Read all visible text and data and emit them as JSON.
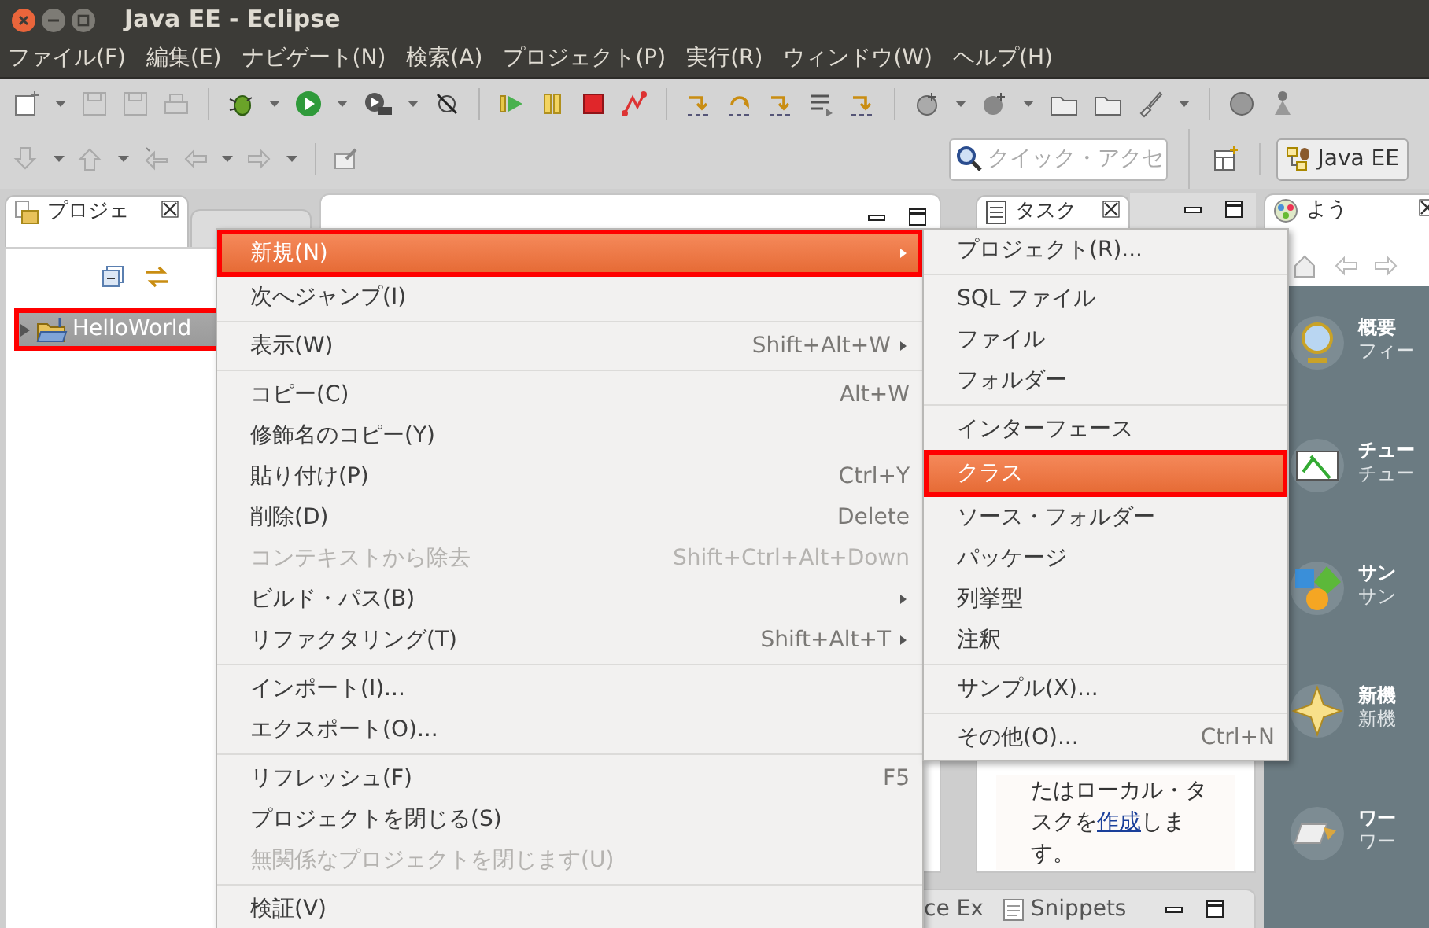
{
  "window": {
    "title": "Java EE - Eclipse"
  },
  "menu_bar": [
    {
      "label": "ファイル(F)"
    },
    {
      "label": "編集(E)"
    },
    {
      "label": "ナビゲート(N)"
    },
    {
      "label": "検索(A)"
    },
    {
      "label": "プロジェクト(P)"
    },
    {
      "label": "実行(R)"
    },
    {
      "label": "ウィンドウ(W)"
    },
    {
      "label": "ヘルプ(H)"
    }
  ],
  "quick_access": {
    "placeholder": "クイック・アクセ"
  },
  "perspective": {
    "label": "Java EE",
    "selected": true
  },
  "project_explorer": {
    "tab": "プロジェ",
    "tree": [
      {
        "label": "HelloWorld",
        "selected": true,
        "framed": true,
        "expanded": false
      }
    ]
  },
  "context_menu": {
    "items": [
      {
        "kind": "item",
        "label": "新規(N)",
        "submenu": true,
        "disabled": false,
        "selected": true,
        "framed": true
      },
      {
        "kind": "item",
        "label": "次へジャンプ(I)",
        "submenu": false,
        "disabled": false,
        "selected": false,
        "framed": false
      },
      {
        "kind": "separator"
      },
      {
        "kind": "item",
        "label": "表示(W)",
        "shortcut": "Shift+Alt+W",
        "submenu": true,
        "disabled": false,
        "selected": false,
        "framed": false
      },
      {
        "kind": "separator"
      },
      {
        "kind": "item",
        "label": "コピー(C)",
        "shortcut": "Alt+W",
        "submenu": false,
        "disabled": false,
        "selected": false,
        "framed": false
      },
      {
        "kind": "item",
        "label": "修飾名のコピー(Y)",
        "submenu": false,
        "disabled": false,
        "selected": false,
        "framed": false
      },
      {
        "kind": "item",
        "label": "貼り付け(P)",
        "shortcut": "Ctrl+Y",
        "submenu": false,
        "disabled": false,
        "selected": false,
        "framed": false
      },
      {
        "kind": "item",
        "label": "削除(D)",
        "shortcut": "Delete",
        "submenu": false,
        "disabled": false,
        "selected": false,
        "framed": false
      },
      {
        "kind": "item",
        "label": "コンテキストから除去",
        "shortcut": "Shift+Ctrl+Alt+Down",
        "submenu": false,
        "disabled": true,
        "selected": false,
        "framed": false
      },
      {
        "kind": "item",
        "label": "ビルド・パス(B)",
        "submenu": true,
        "disabled": false,
        "selected": false,
        "framed": false
      },
      {
        "kind": "item",
        "label": "リファクタリング(T)",
        "shortcut": "Shift+Alt+T",
        "submenu": true,
        "disabled": false,
        "selected": false,
        "framed": false
      },
      {
        "kind": "separator"
      },
      {
        "kind": "item",
        "label": "インポート(I)...",
        "submenu": false,
        "disabled": false,
        "selected": false,
        "framed": false
      },
      {
        "kind": "item",
        "label": "エクスポート(O)...",
        "submenu": false,
        "disabled": false,
        "selected": false,
        "framed": false
      },
      {
        "kind": "separator"
      },
      {
        "kind": "item",
        "label": "リフレッシュ(F)",
        "shortcut": "F5",
        "submenu": false,
        "disabled": false,
        "selected": false,
        "framed": false
      },
      {
        "kind": "item",
        "label": "プロジェクトを閉じる(S)",
        "submenu": false,
        "disabled": false,
        "selected": false,
        "framed": false
      },
      {
        "kind": "item",
        "label": "無関係なプロジェクトを閉じます(U)",
        "submenu": false,
        "disabled": true,
        "selected": false,
        "framed": false
      },
      {
        "kind": "separator"
      },
      {
        "kind": "item",
        "label": "検証(V)",
        "submenu": false,
        "disabled": false,
        "selected": false,
        "framed": false
      }
    ]
  },
  "submenu": {
    "items": [
      {
        "kind": "item",
        "label": "プロジェクト(R)...",
        "submenu": false,
        "disabled": false,
        "selected": false,
        "framed": false
      },
      {
        "kind": "separator"
      },
      {
        "kind": "item",
        "label": "SQL ファイル",
        "submenu": false,
        "disabled": false,
        "selected": false,
        "framed": false
      },
      {
        "kind": "item",
        "label": "ファイル",
        "submenu": false,
        "disabled": false,
        "selected": false,
        "framed": false
      },
      {
        "kind": "item",
        "label": "フォルダー",
        "submenu": false,
        "disabled": false,
        "selected": false,
        "framed": false
      },
      {
        "kind": "separator"
      },
      {
        "kind": "item",
        "label": "インターフェース",
        "submenu": false,
        "disabled": false,
        "selected": false,
        "framed": false
      },
      {
        "kind": "item",
        "label": "クラス",
        "submenu": false,
        "disabled": false,
        "selected": true,
        "framed": true
      },
      {
        "kind": "item",
        "label": "ソース・フォルダー",
        "submenu": false,
        "disabled": false,
        "selected": false,
        "framed": false
      },
      {
        "kind": "item",
        "label": "パッケージ",
        "submenu": false,
        "disabled": false,
        "selected": false,
        "framed": false
      },
      {
        "kind": "item",
        "label": "列挙型",
        "submenu": false,
        "disabled": false,
        "selected": false,
        "framed": false
      },
      {
        "kind": "item",
        "label": "注釈",
        "submenu": false,
        "disabled": false,
        "selected": false,
        "framed": false
      },
      {
        "kind": "separator"
      },
      {
        "kind": "item",
        "label": "サンプル(X)...",
        "submenu": false,
        "disabled": false,
        "selected": false,
        "framed": false
      },
      {
        "kind": "separator"
      },
      {
        "kind": "item",
        "label": "その他(O)...",
        "shortcut": "Ctrl+N",
        "submenu": false,
        "disabled": false,
        "selected": false,
        "framed": false
      }
    ]
  },
  "task_list": {
    "tab": "タスク",
    "hint": {
      "before": "たはローカル・タスクを",
      "link": "作成",
      "after": "します。"
    }
  },
  "bottom_panel": {
    "tabs": [
      {
        "label": "ce Ex"
      },
      {
        "label": "Snippets"
      }
    ]
  },
  "welcome": {
    "tab": "よう",
    "items": [
      {
        "title": "概要",
        "subtitle": "フィー"
      },
      {
        "title": "チュー",
        "subtitle": "チュー"
      },
      {
        "title": "サン",
        "subtitle": "サン"
      },
      {
        "title": "新機",
        "subtitle": "新機"
      },
      {
        "title": "ワー",
        "subtitle": "ワー"
      }
    ]
  }
}
